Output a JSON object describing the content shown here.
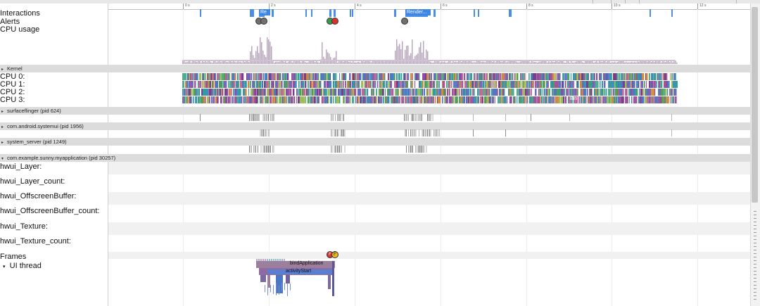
{
  "ruler_ticks": [
    {
      "label": "0 s",
      "frac": 0.116
    },
    {
      "label": "2 s",
      "frac": 0.25
    },
    {
      "label": "4 s",
      "frac": 0.384
    },
    {
      "label": "6 s",
      "frac": 0.517
    },
    {
      "label": "8 s",
      "frac": 0.651
    },
    {
      "label": "10 s",
      "frac": 0.784
    },
    {
      "label": "12 s",
      "frac": 0.918
    }
  ],
  "tracks": {
    "interactions": "Interactions",
    "alerts": "Alerts",
    "cpu_usage": "CPU usage",
    "cpu0": "CPU 0:",
    "cpu1": "CPU 1:",
    "cpu2": "CPU 2:",
    "cpu3": "CPU 3:"
  },
  "processes": {
    "kernel": "Kernel",
    "surfaceflinger": "surfaceflinger (pid 624)",
    "systemui": "com.android.systemui (pid 1956)",
    "system_server": "system_server (pid 1249)",
    "myapp": "com.example.sunny.myapplication (pid 30257)"
  },
  "counters": {
    "layer": "hwui_Layer:",
    "layer_count": "hwui_Layer_count:",
    "offscreen": "hwui_OffscreenBuffer:",
    "offscreen_count": "hwui_OffscreenBuffer_count:",
    "texture": "hwui_Texture:",
    "texture_count": "hwui_Texture_count:"
  },
  "threads": {
    "frames": "Frames",
    "ui_thread": "UI thread"
  },
  "interaction_labels": {
    "re": "Re",
    "render": "Render..."
  },
  "cpu_slice_label": "Bin",
  "slices": {
    "bind_application": "bindApplication",
    "activity_start": "activityStart"
  },
  "alert_glyph": "F",
  "colors": {
    "interaction": "#4a8ee8",
    "cpu_usage": "#b9a7bd",
    "band": "#dcdcdc",
    "thread_slice": "#9c7f9c",
    "alert_red": "#d9342b",
    "alert_yellow": "#e8b820",
    "alert_gray": "#6f6f6f"
  }
}
